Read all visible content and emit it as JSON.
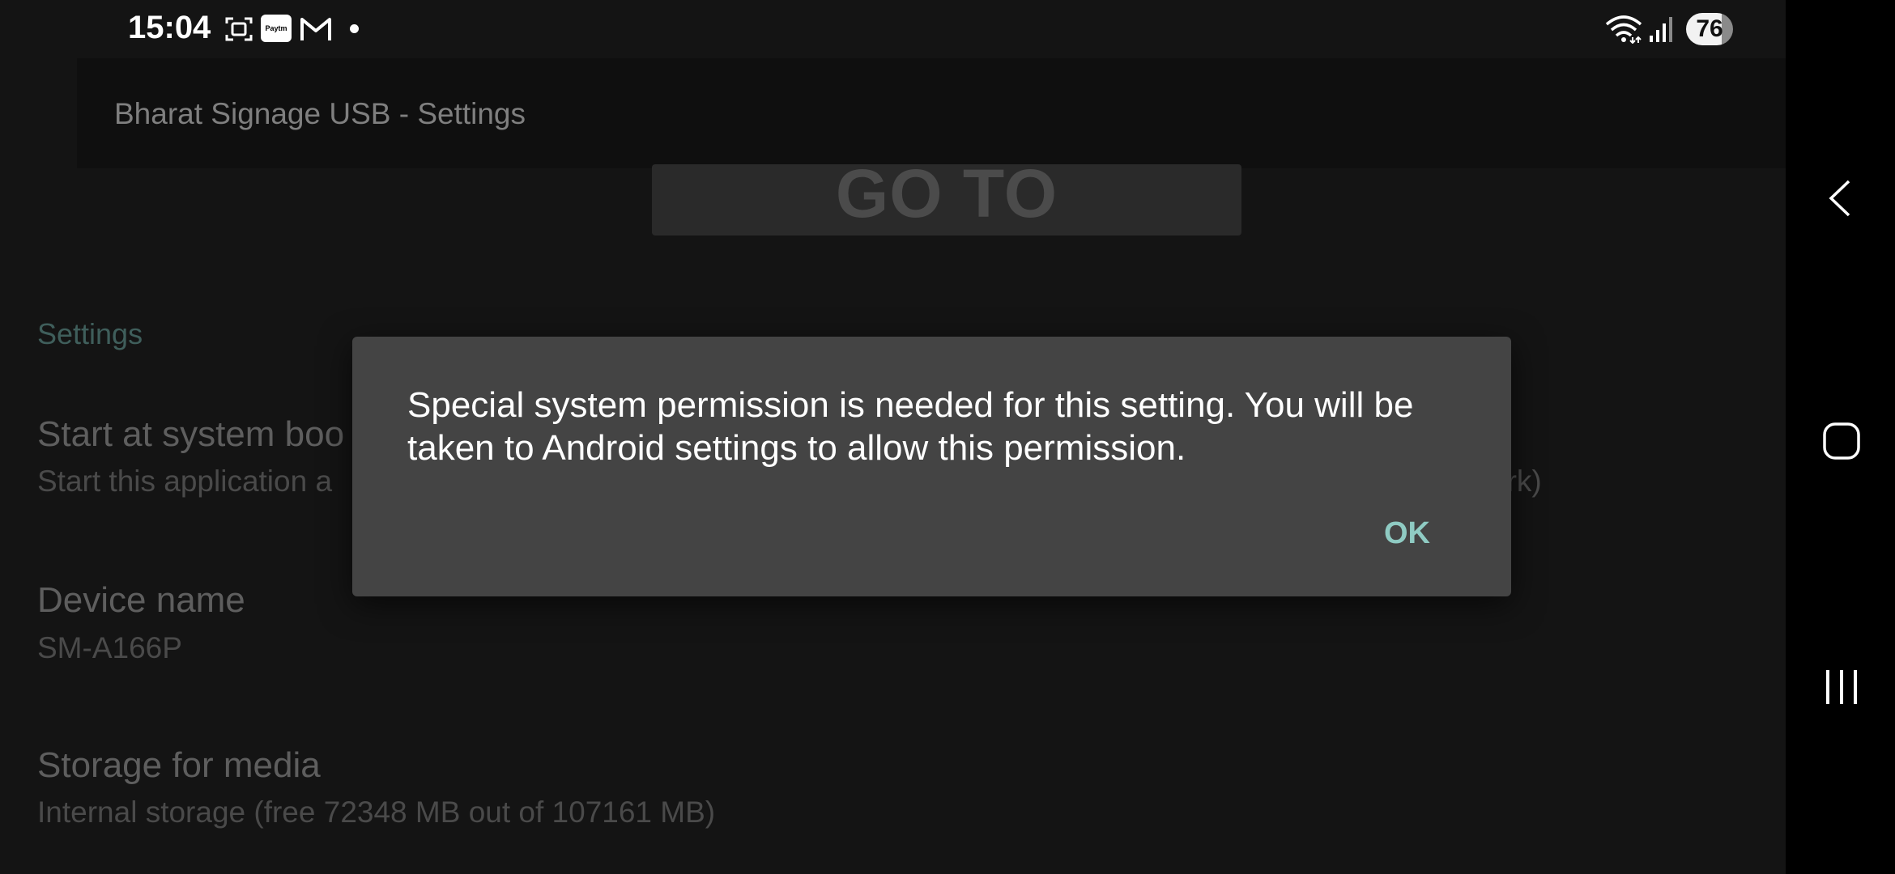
{
  "status_bar": {
    "time": "15:04",
    "icons": [
      "screenshot-icon",
      "paytm-icon",
      "gmail-icon",
      "notification-dot-icon",
      "wifi-icon",
      "signal-icon"
    ],
    "paytm_text": "Paytm",
    "battery": "76"
  },
  "toolbar": {
    "title": "Bharat Signage USB - Settings"
  },
  "playback_button": {
    "label": "GO TO PLAYBACK"
  },
  "settings": {
    "section_header": "Settings",
    "start_at_boot": {
      "title": "Start at system boo",
      "summary": "Start this application a",
      "summary_tail": "ork)"
    },
    "device_name": {
      "title": "Device name",
      "summary": "SM-A166P"
    },
    "storage": {
      "title": "Storage for media",
      "summary": "Internal storage (free 72348 MB out of 107161 MB)"
    }
  },
  "dialog": {
    "message": "Special system permission is needed for this setting. You will be taken to Android settings to allow this permission.",
    "ok_label": "OK",
    "accent_color": "#8fcbc3"
  },
  "navigation": {
    "icons": [
      "back-icon",
      "home-icon",
      "recents-icon"
    ]
  }
}
